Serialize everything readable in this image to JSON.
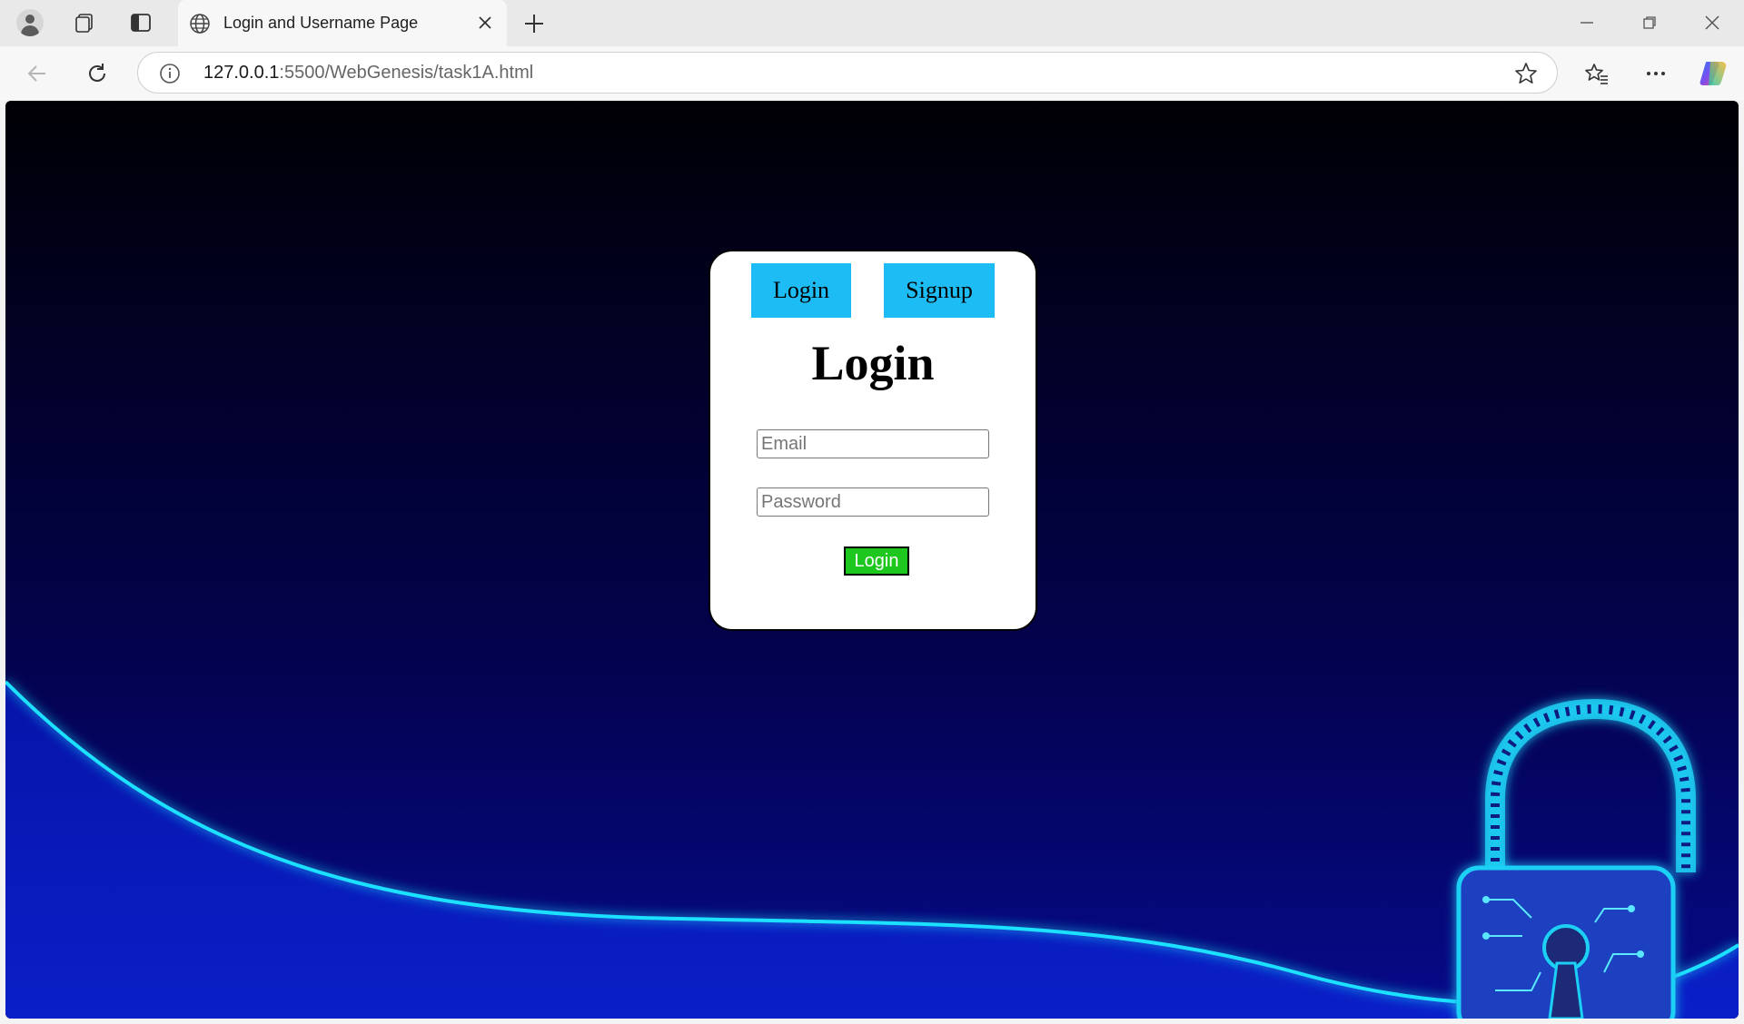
{
  "browser": {
    "tab_title": "Login and Username Page",
    "url_host": "127.0.0.1",
    "url_path": ":5500/WebGenesis/task1A.html"
  },
  "page": {
    "tabs": {
      "login_label": "Login",
      "signup_label": "Signup"
    },
    "heading": "Login",
    "email_placeholder": "Email",
    "password_placeholder": "Password",
    "submit_label": "Login"
  },
  "colors": {
    "tab_button": "#1ebcf5",
    "submit_button": "#1ec71e",
    "background_top": "#000004",
    "background_bottom": "#060a8a",
    "neon": "#1ee0ff"
  }
}
